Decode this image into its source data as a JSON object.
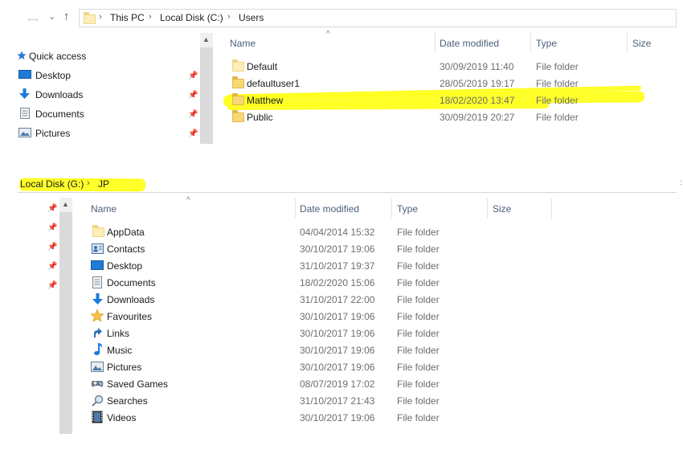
{
  "top": {
    "nav": {
      "back": "→",
      "forward": "→",
      "recent": "⌄",
      "up": "↑"
    },
    "address": {
      "parts": [
        "This PC",
        "Local Disk (C:)",
        "Users"
      ],
      "separator": "›"
    },
    "sidebar": {
      "items": [
        {
          "label": "Quick access",
          "icon": "star-icon"
        },
        {
          "label": "Desktop",
          "icon": "desktop-icon"
        },
        {
          "label": "Downloads",
          "icon": "download-icon"
        },
        {
          "label": "Documents",
          "icon": "documents-icon"
        },
        {
          "label": "Pictures",
          "icon": "pictures-icon"
        }
      ]
    },
    "columns": {
      "name": "Name",
      "date": "Date modified",
      "type": "Type",
      "size": "Size"
    },
    "rows": [
      {
        "name": "Default",
        "date": "30/09/2019 11:40",
        "type": "File folder"
      },
      {
        "name": "defaultuser1",
        "date": "28/05/2019 19:17",
        "type": "File folder"
      },
      {
        "name": "Matthew",
        "date": "18/02/2020 13:47",
        "type": "File folder"
      },
      {
        "name": "Public",
        "date": "30/09/2019 20:27",
        "type": "File folder"
      }
    ],
    "highlight_color": "#ffff1e"
  },
  "bottom": {
    "breadcrumb": {
      "drive": "Local Disk (G:)",
      "separator": "›",
      "folder": "JP"
    },
    "columns": {
      "name": "Name",
      "date": "Date modified",
      "type": "Type",
      "size": "Size"
    },
    "rows": [
      {
        "name": "AppData",
        "date": "04/04/2014 15:32",
        "type": "File folder",
        "icon": "folder-icon"
      },
      {
        "name": "Contacts",
        "date": "30/10/2017 19:06",
        "type": "File folder",
        "icon": "contacts-icon"
      },
      {
        "name": "Desktop",
        "date": "31/10/2017 19:37",
        "type": "File folder",
        "icon": "desktop-icon"
      },
      {
        "name": "Documents",
        "date": "18/02/2020 15:06",
        "type": "File folder",
        "icon": "documents-icon"
      },
      {
        "name": "Downloads",
        "date": "31/10/2017 22:00",
        "type": "File folder",
        "icon": "download-icon"
      },
      {
        "name": "Favourites",
        "date": "30/10/2017 19:06",
        "type": "File folder",
        "icon": "star-icon"
      },
      {
        "name": "Links",
        "date": "30/10/2017 19:06",
        "type": "File folder",
        "icon": "link-icon"
      },
      {
        "name": "Music",
        "date": "30/10/2017 19:06",
        "type": "File folder",
        "icon": "music-icon"
      },
      {
        "name": "Pictures",
        "date": "30/10/2017 19:06",
        "type": "File folder",
        "icon": "pictures-icon"
      },
      {
        "name": "Saved Games",
        "date": "08/07/2019 17:02",
        "type": "File folder",
        "icon": "saved-games-icon"
      },
      {
        "name": "Searches",
        "date": "31/10/2017 21:43",
        "type": "File folder",
        "icon": "search-icon"
      },
      {
        "name": "Videos",
        "date": "30/10/2017 19:06",
        "type": "File folder",
        "icon": "videos-icon"
      }
    ]
  },
  "colors": {
    "header_text": "#4c607a",
    "accent_blue": "#1e7bd6",
    "folder_yellow": "#f8d775"
  }
}
